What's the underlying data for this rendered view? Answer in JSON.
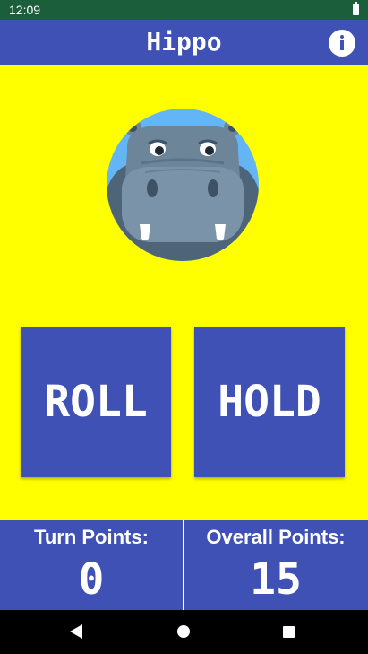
{
  "status_bar": {
    "time": "12:09"
  },
  "app_bar": {
    "title": "Hippo"
  },
  "buttons": {
    "roll_label": "ROLL",
    "hold_label": "HOLD"
  },
  "scores": {
    "turn_label": "Turn Points:",
    "turn_value": "0",
    "overall_label": "Overall Points:",
    "overall_value": "15"
  },
  "icons": {
    "info": "info-icon",
    "battery": "battery-icon",
    "back": "back-icon",
    "home": "home-icon",
    "recent": "recent-apps-icon"
  },
  "colors": {
    "primary": "#3f51b5",
    "background": "#ffff00",
    "status_bar": "#1b5e3b"
  }
}
